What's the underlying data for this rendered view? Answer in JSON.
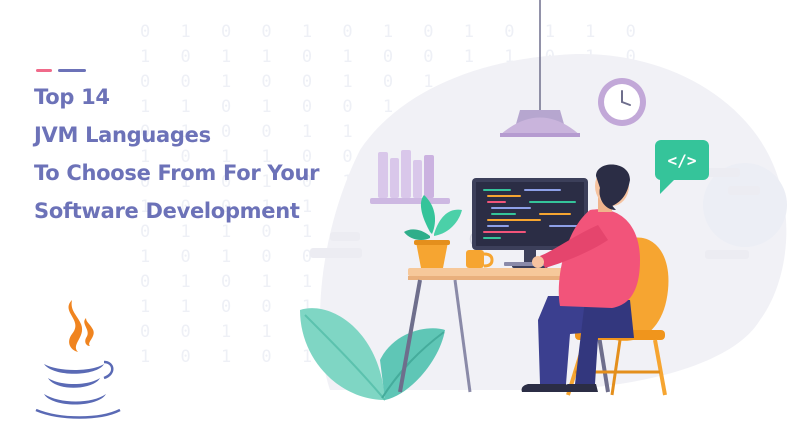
{
  "headline": {
    "lines": [
      "Top 14",
      "JVM Languages",
      "To Choose From For Your",
      "Software Development"
    ]
  },
  "code_bubble": {
    "text": "</>"
  },
  "colors": {
    "headline": "#6c72b8",
    "accent_pink": "#f06a8a",
    "accent_purple": "#6c72b8",
    "bubble_green": "#35c49a",
    "shirt_pink": "#f2547a",
    "pants_navy": "#3b3f8f",
    "chair_orange": "#f6a531",
    "java_orange": "#f0841f",
    "java_blue": "#5a6ab5"
  },
  "icons": [
    "java-logo-icon",
    "code-icon",
    "wall-clock-icon",
    "pendant-lamp-icon"
  ]
}
